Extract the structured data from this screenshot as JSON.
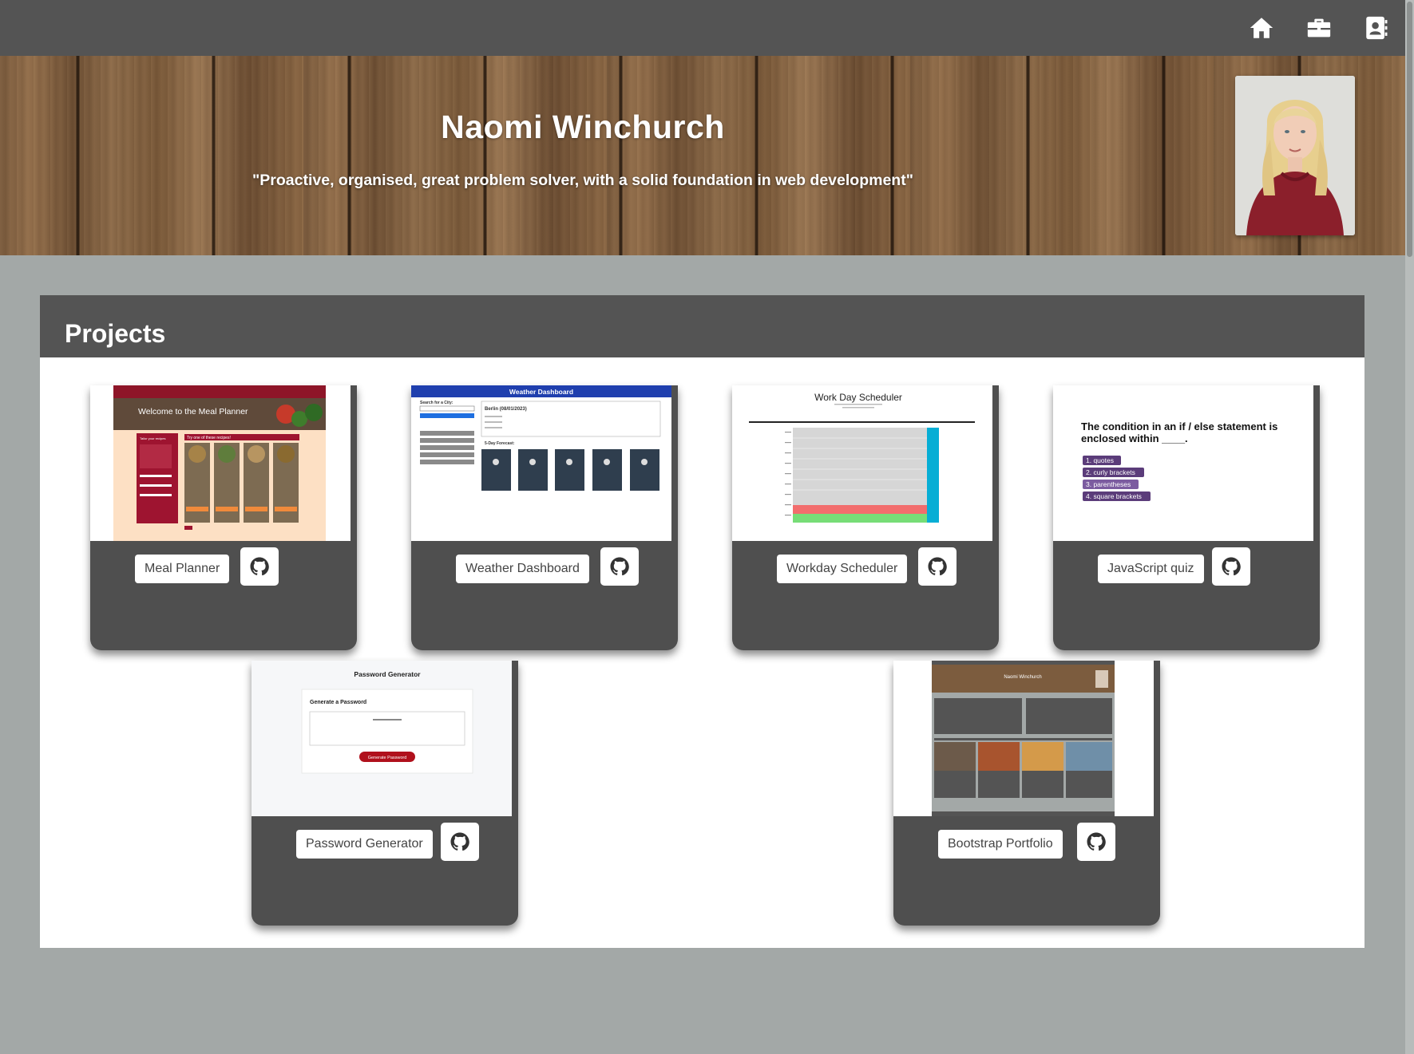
{
  "nav": {
    "icons": [
      "home-icon",
      "briefcase-icon",
      "contact-card-icon"
    ]
  },
  "header": {
    "name": "Naomi Winchurch",
    "tagline": "\"Proactive, organised, great problem solver, with a solid foundation in web development\""
  },
  "projects": {
    "title": "Projects",
    "cards": [
      {
        "label": "Meal Planner",
        "shot": {
          "banner": "Welcome to the Meal Planner",
          "sidebar_heading": "Tailor your recipes",
          "list_heading": "Try one of these recipes!"
        }
      },
      {
        "label": "Weather Dashboard",
        "shot": {
          "title": "Weather Dashboard",
          "search_label": "Search for a City:",
          "city": "Berlin (08/01/2023)",
          "forecast_label": "5-Day Forecast:"
        }
      },
      {
        "label": "Workday Scheduler",
        "shot": {
          "title": "Work Day Scheduler"
        }
      },
      {
        "label": "JavaScript quiz",
        "shot": {
          "question": "The condition in an if / else statement is enclosed within ____.",
          "answers": [
            "1. quotes",
            "2. curly brackets",
            "3. parentheses",
            "4. square brackets"
          ]
        }
      },
      {
        "label": "Password Generator",
        "shot": {
          "title": "Password Generator",
          "card_heading": "Generate a Password",
          "button": "Generate Password"
        }
      },
      {
        "label": "Bootstrap Portfolio",
        "shot": {
          "title": "Naomi Winchurch"
        }
      }
    ]
  },
  "colors": {
    "page_bg": "#a3a8a7",
    "bar": "#545454",
    "card": "#4f4f4f",
    "accent_red": "#a3172b",
    "accent_blue": "#1f3fae",
    "quiz_purple": "#5b3c7a"
  }
}
